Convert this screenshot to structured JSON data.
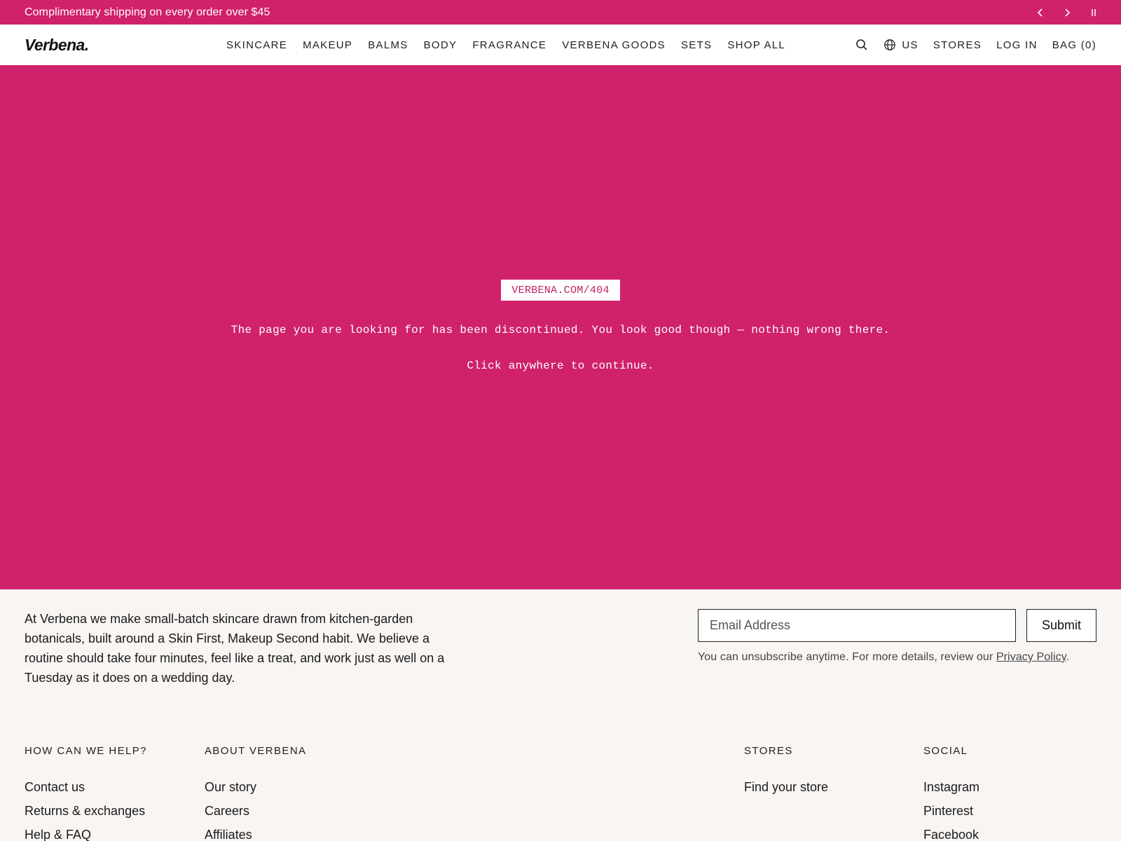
{
  "announcement": {
    "text": "Complimentary shipping on every order over $45",
    "controls": [
      "chevron-left-icon",
      "chevron-right-icon",
      "pause-icon"
    ]
  },
  "header": {
    "logo": "Verbena.",
    "nav": [
      "SKINCARE",
      "MAKEUP",
      "BALMS",
      "BODY",
      "FRAGRANCE",
      "VERBENA GOODS",
      "SETS",
      "SHOP ALL"
    ],
    "locale": "US",
    "stores": "STORES",
    "login": "LOG IN",
    "bag": "BAG (0)"
  },
  "error_page": {
    "url_badge": "VERBENA.COM/404",
    "message": "The page you are looking for has been discontinued. You look good though — nothing wrong there.",
    "continue_text": "Click anywhere to continue."
  },
  "footer": {
    "about": "At Verbena we make small-batch skincare drawn from kitchen-garden botanicals, built around a Skin First, Makeup Second habit. We believe a routine should take four minutes, feel like a treat, and work just as well on a Tuesday as it does on a wedding day.",
    "newsletter": {
      "placeholder": "Email Address",
      "submit_label": "Submit",
      "note": "You can unsubscribe anytime. For more details, review our",
      "policy_link": "Privacy Policy",
      "note_end": "."
    },
    "columns": [
      {
        "heading": "HOW CAN WE HELP?",
        "links": [
          "Contact us",
          "Returns & exchanges",
          "Help & FAQ"
        ]
      },
      {
        "heading": "ABOUT VERBENA",
        "links": [
          "Our story",
          "Careers",
          "Affiliates"
        ]
      },
      {
        "heading": "STORES",
        "links": [
          "Find your store"
        ]
      },
      {
        "heading": "SOCIAL",
        "links": [
          "Instagram",
          "Pinterest",
          "Facebook"
        ]
      }
    ]
  },
  "colors": {
    "accent": "#d0216b",
    "footer_bg": "#f8f5f3",
    "header_bg": "#ffffff"
  }
}
